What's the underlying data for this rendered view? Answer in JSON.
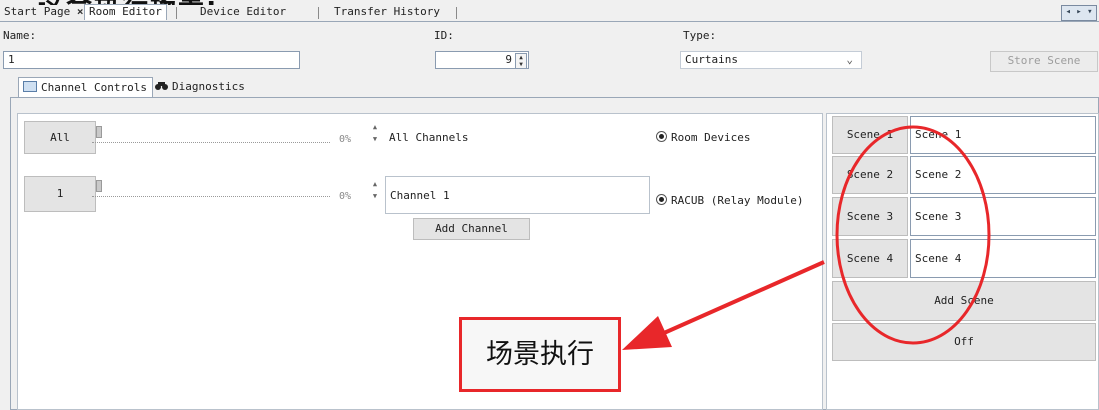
{
  "caption": "这合执行场景:",
  "tabs": [
    "Start Page",
    "Room Editor",
    "Device Editor",
    "Transfer History"
  ],
  "tab_close": "×",
  "window_buttons": "◂ ▸ ▾",
  "labels": {
    "name": "Name:",
    "id": "ID:",
    "type": "Type:"
  },
  "fields": {
    "name_value": "1",
    "id_value": "9",
    "type_value": "Curtains"
  },
  "store_scene": "Store Scene",
  "subtabs": [
    "Channel Controls",
    "Diagnostics"
  ],
  "channels": [
    {
      "button": "All",
      "percent": "0%",
      "name": "All Channels",
      "radio": "Room Devices"
    },
    {
      "button": "1",
      "percent": "0%",
      "name": "Channel 1",
      "radio": "RACUB (Relay Module)"
    }
  ],
  "add_channel": "Add Channel",
  "scenes": [
    {
      "button": "Scene 1",
      "name": "Scene 1"
    },
    {
      "button": "Scene 2",
      "name": "Scene 2"
    },
    {
      "button": "Scene 3",
      "name": "Scene 3"
    },
    {
      "button": "Scene 4",
      "name": "Scene 4"
    }
  ],
  "add_scene": "Add Scene",
  "off": "Off",
  "annotation": "场景执行",
  "colors": {
    "annotation_red": "#e8272a"
  }
}
